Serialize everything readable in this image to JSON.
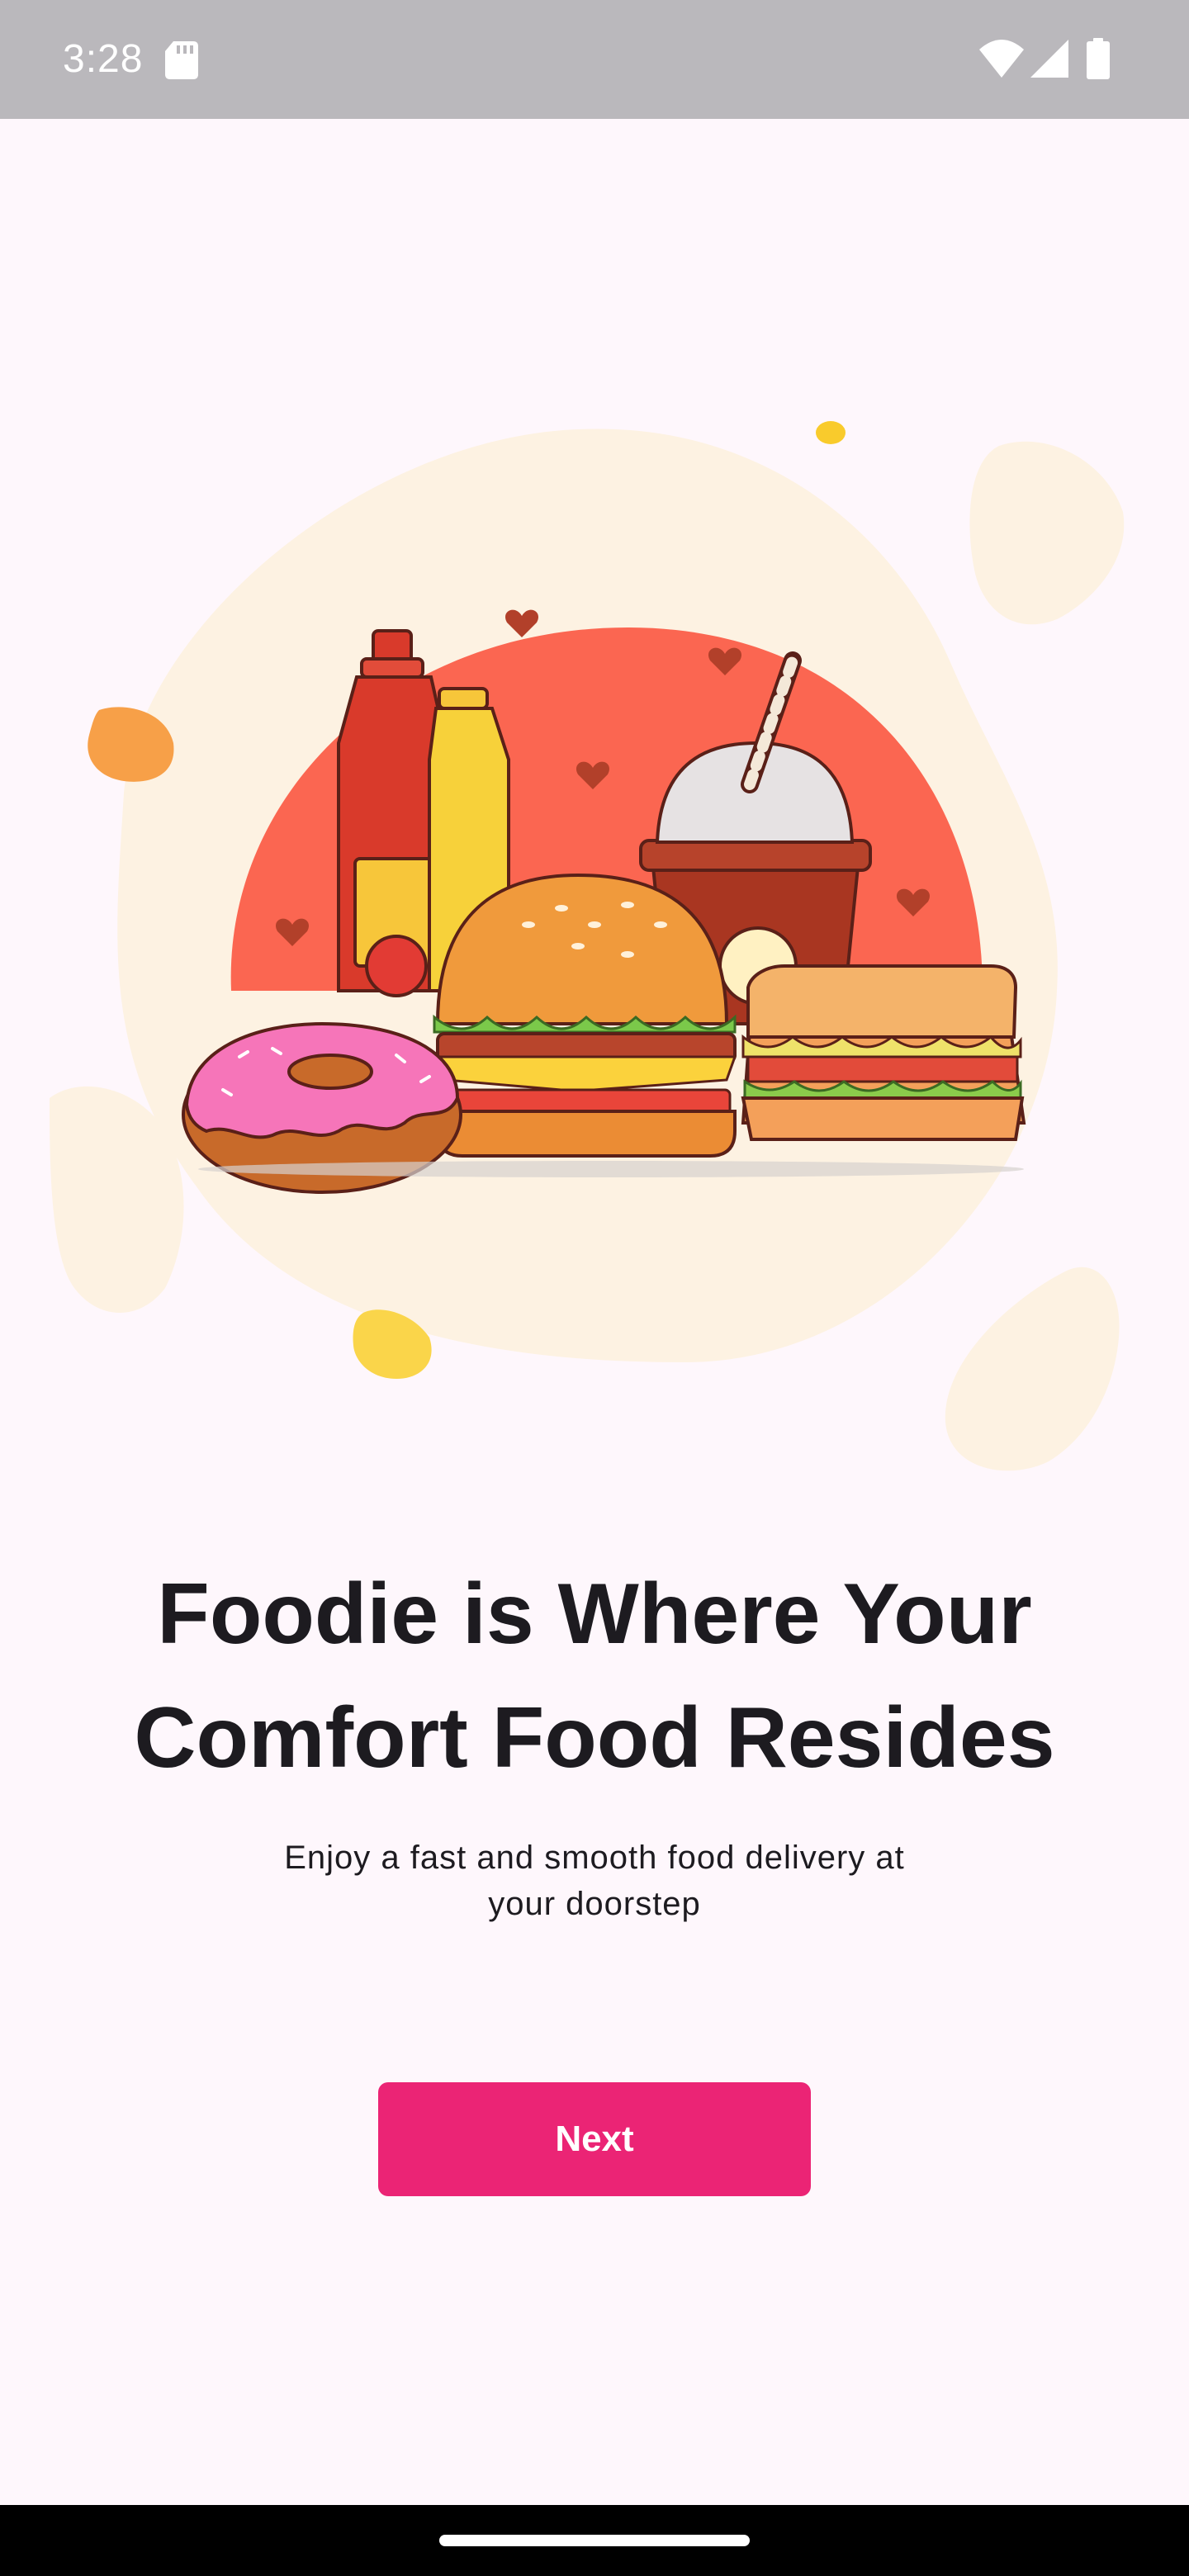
{
  "status_bar": {
    "time": "3:28",
    "icons": [
      "sd-card-icon",
      "wifi-icon",
      "signal-icon",
      "battery-icon"
    ]
  },
  "hero": {
    "image": "fast-food-illustration",
    "items": [
      "ketchup-bottle",
      "mustard-bottle",
      "burger",
      "donut",
      "soda-cup",
      "sandwich"
    ]
  },
  "onboarding": {
    "title_line1": "Foodie is Where Your",
    "title_line2": "Comfort Food Resides",
    "subtitle_line1": "Enjoy a fast and smooth food delivery at",
    "subtitle_line2": "your doorstep",
    "next_label": "Next"
  },
  "colors": {
    "background": "#FEF7FC",
    "accent": "#EB2475",
    "status_bar": "#BAB8BC",
    "text": "#1D1B20"
  }
}
